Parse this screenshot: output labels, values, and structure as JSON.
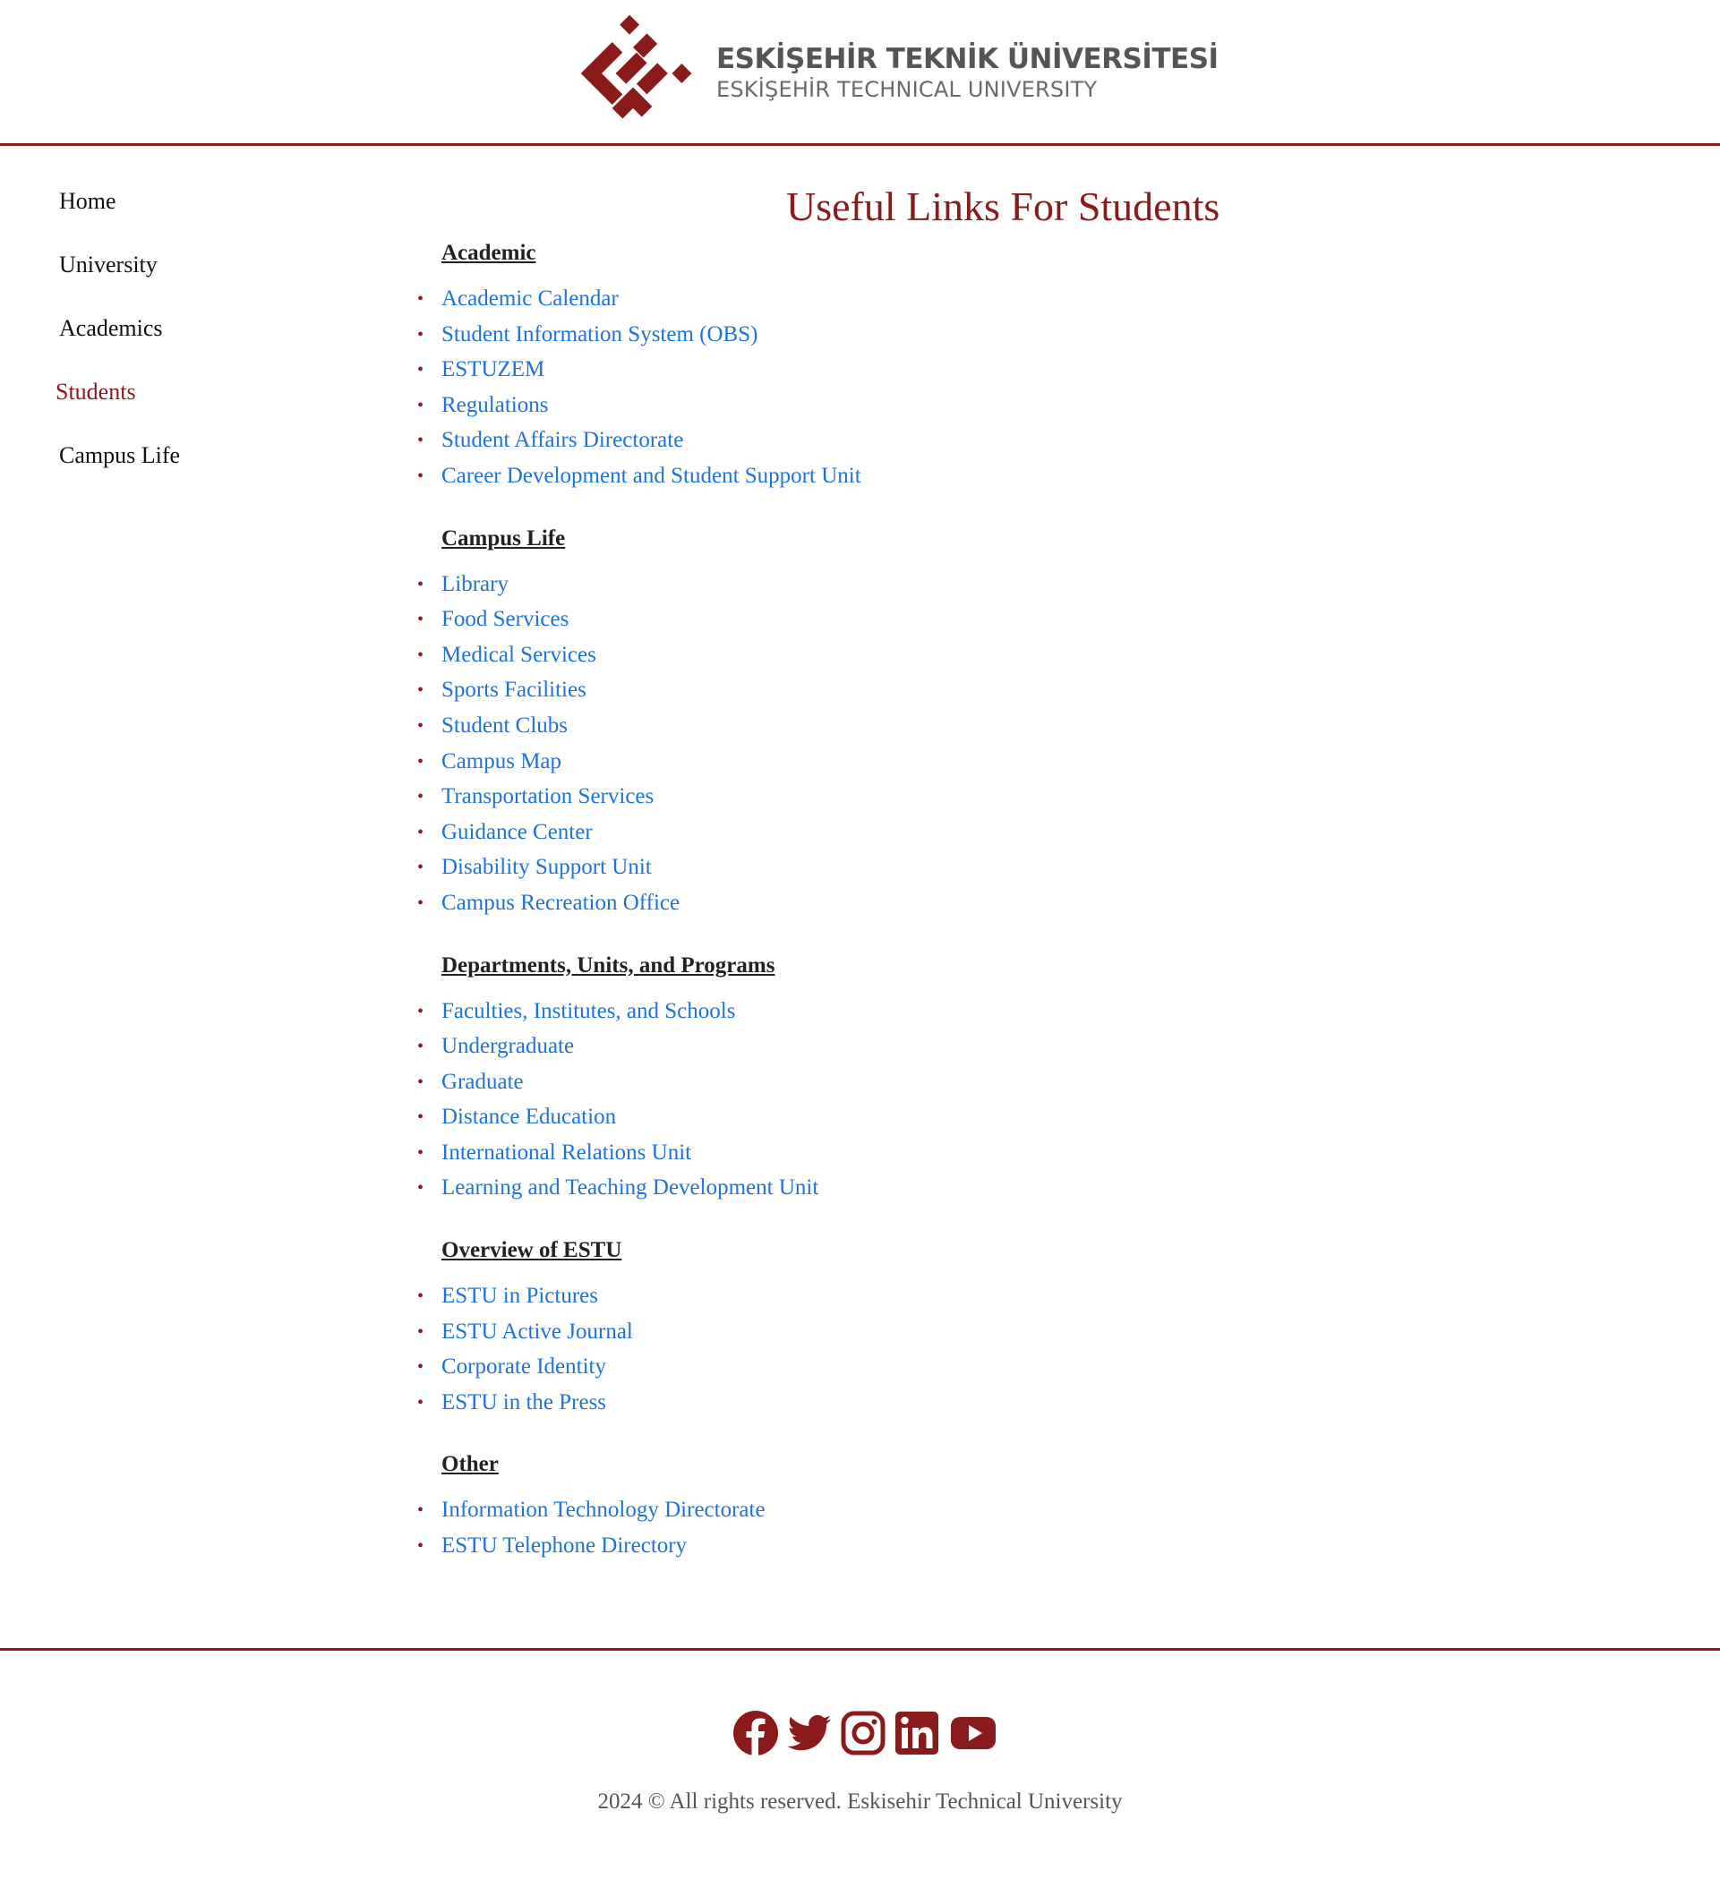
{
  "header": {
    "logo_line1": "ESKİŞEHİR TEKNİK ÜNİVERSİTESİ",
    "logo_line2": "ESKİŞEHİR TECHNICAL UNIVERSITY",
    "logo_icon": "estu-logo-mark",
    "brand_color": "#8b1a1a"
  },
  "sidebar": {
    "items": [
      {
        "label": "Home",
        "active": false
      },
      {
        "label": "University",
        "active": false
      },
      {
        "label": "Academics",
        "active": false
      },
      {
        "label": "Students",
        "active": true
      },
      {
        "label": "Campus Life",
        "active": false
      }
    ]
  },
  "main": {
    "title": "Useful Links For Students",
    "sections": [
      {
        "heading": "Academic",
        "links": [
          "Academic Calendar",
          "Student Information System (OBS)",
          "ESTUZEM",
          "Regulations",
          "Student Affairs Directorate",
          "Career Development and Student Support Unit"
        ]
      },
      {
        "heading": "Campus Life",
        "links": [
          "Library",
          "Food Services",
          "Medical Services",
          "Sports Facilities",
          "Student Clubs",
          "Campus Map",
          "Transportation Services",
          "Guidance Center",
          "Disability Support Unit",
          "Campus Recreation Office"
        ]
      },
      {
        "heading": "Departments, Units, and Programs",
        "links": [
          "Faculties, Institutes, and Schools",
          "Undergraduate",
          "Graduate",
          "Distance Education",
          "International Relations Unit",
          "Learning and Teaching Development Unit"
        ]
      },
      {
        "heading": "Overview of ESTU",
        "links": [
          "ESTU in Pictures",
          "ESTU Active Journal",
          "Corporate Identity",
          "ESTU in the Press"
        ]
      },
      {
        "heading": "Other",
        "links": [
          "Information Technology Directorate",
          "ESTU Telephone Directory"
        ]
      }
    ]
  },
  "footer": {
    "social_icons": [
      "facebook-icon",
      "twitter-icon",
      "instagram-icon",
      "linkedin-icon",
      "youtube-icon"
    ],
    "copyright": "2024 © All rights reserved. Eskisehir Technical University"
  },
  "colors": {
    "accent": "#8b1a1a",
    "link": "#1e73d8",
    "text": "#111111",
    "muted": "#555555"
  }
}
